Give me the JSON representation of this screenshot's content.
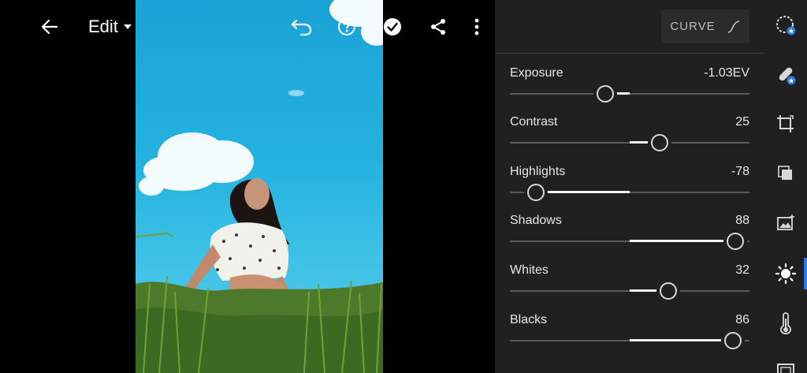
{
  "toolbar": {
    "edit_label": "Edit"
  },
  "curve": {
    "label": "CURVE"
  },
  "sliders": [
    {
      "name": "Exposure",
      "value_text": "-1.03EV",
      "value": -1.03,
      "min": -5,
      "max": 5
    },
    {
      "name": "Contrast",
      "value_text": "25",
      "value": 25,
      "min": -100,
      "max": 100
    },
    {
      "name": "Highlights",
      "value_text": "-78",
      "value": -78,
      "min": -100,
      "max": 100
    },
    {
      "name": "Shadows",
      "value_text": "88",
      "value": 88,
      "min": -100,
      "max": 100
    },
    {
      "name": "Whites",
      "value_text": "32",
      "value": 32,
      "min": -100,
      "max": 100
    },
    {
      "name": "Blacks",
      "value_text": "86",
      "value": 86,
      "min": -100,
      "max": 100
    }
  ],
  "rail": {
    "items": [
      "presets-icon",
      "healing-icon",
      "crop-icon",
      "layers-icon",
      "auto-icon",
      "light-icon",
      "color-icon",
      "effects-icon"
    ],
    "active": "light-icon",
    "accent_color": "#2d7be5"
  }
}
